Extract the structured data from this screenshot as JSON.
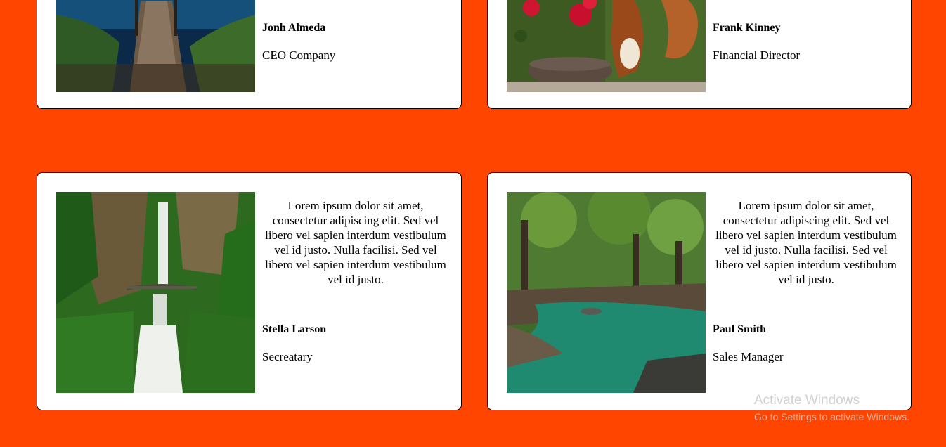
{
  "cards": [
    {
      "name": "Jonh Almeda",
      "role": "CEO Company",
      "image": "lake-pier-photo"
    },
    {
      "name": "Frank Kinney",
      "role": "Financial Director",
      "image": "squirrel-flowers-photo"
    },
    {
      "name": "Stella Larson",
      "role": "Secreatary",
      "image": "waterfall-photo",
      "quote": "Lorem ipsum dolor sit amet, consectetur adipiscing elit. Sed vel libero vel sapien interdum vestibulum vel id justo. Nulla facilisi. Sed vel libero vel sapien interdum vestibulum vel id justo."
    },
    {
      "name": "Paul Smith",
      "role": "Sales Manager",
      "image": "forest-river-photo",
      "quote": "Lorem ipsum dolor sit amet, consectetur adipiscing elit. Sed vel libero vel sapien interdum vestibulum vel id justo. Nulla facilisi. Sed vel libero vel sapien interdum vestibulum vel id justo."
    }
  ],
  "watermark": {
    "title": "Activate Windows",
    "subtitle": "Go to Settings to activate Windows."
  },
  "colors": {
    "background": "#ff4500",
    "card": "#ffffff",
    "border": "#000000"
  }
}
